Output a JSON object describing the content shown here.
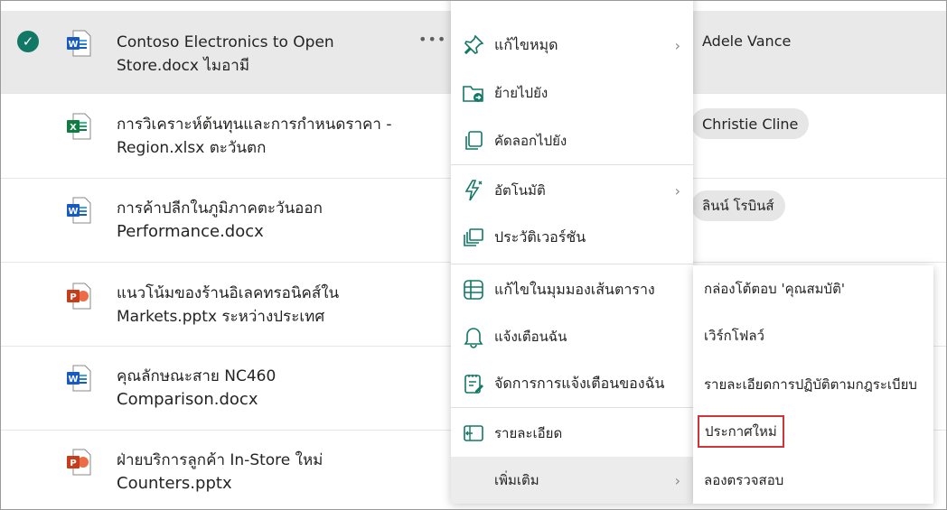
{
  "files": [
    {
      "name_line1": "Contoso Electronics to Open",
      "name_line2": "Store.docx ไมอามี",
      "type": "word",
      "person": "Adele Vance",
      "selected": true
    },
    {
      "name_line1": "การวิเคราะห์ต้นทุนและการกำหนดราคา -",
      "name_line2": "Region.xlsx ตะวันตก",
      "type": "excel",
      "person": "Christie Cline"
    },
    {
      "name_line1": "การค้าปลีกในภูมิภาคตะวันออก",
      "name_line2": "Performance.docx",
      "type": "word",
      "person": "ลินน์ โรบินส์"
    },
    {
      "name_line1": "แนวโน้มของร้านอิเลคทรอนิคส์ใน",
      "name_line2": "Markets.pptx ระหว่างประเทศ",
      "type": "powerpoint",
      "person": ""
    },
    {
      "name_line1": "คุณลักษณะสาย NC460",
      "name_line2": "Comparison.docx",
      "type": "word",
      "person": ""
    },
    {
      "name_line1": "ฝ่ายบริการลูกค้า In-Store ใหม่",
      "name_line2": "Counters.pptx",
      "type": "powerpoint",
      "person": ""
    }
  ],
  "more_dots": "•••",
  "menu": {
    "items": [
      {
        "label": "แก้ไขหมุด",
        "icon": "pin-icon",
        "submenu": true
      },
      {
        "label": "ย้ายไปยัง",
        "icon": "move-to-icon"
      },
      {
        "label": "คัดลอกไปยัง",
        "icon": "copy-to-icon"
      },
      {
        "label": "อัตโนมัติ",
        "icon": "automate-icon",
        "submenu": true
      },
      {
        "label": "ประวัติเวอร์ชัน",
        "icon": "version-history-icon"
      },
      {
        "label": "แก้ไขในมุมมองเส้นตาราง",
        "icon": "grid-view-icon"
      },
      {
        "label": "แจ้งเตือนฉัน",
        "icon": "bell-icon"
      },
      {
        "label": "จัดการการแจ้งเตือนของฉัน",
        "icon": "manage-alerts-icon"
      },
      {
        "label": "รายละเอียด",
        "icon": "details-icon"
      },
      {
        "label": "เพิ่มเติม",
        "icon": "",
        "submenu": true
      }
    ]
  },
  "submenu": {
    "items": [
      {
        "label": "กล่องโต้ตอบ 'คุณสมบัติ'"
      },
      {
        "label": "เวิร์กโฟลว์"
      },
      {
        "label": "รายละเอียดการปฏิบัติตามกฎระเบียบ"
      },
      {
        "label": "ประกาศใหม่",
        "highlighted": true
      },
      {
        "label": "ลองตรวจสอบ"
      }
    ]
  },
  "colors": {
    "check": "#117865",
    "word": "#185abd",
    "excel": "#107c41",
    "powerpoint": "#c43e1c",
    "highlight_box": "#d13438"
  }
}
